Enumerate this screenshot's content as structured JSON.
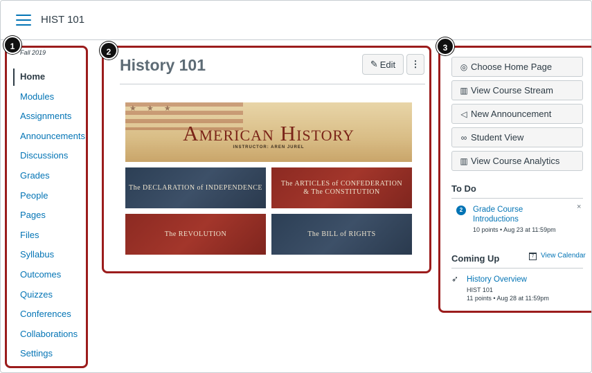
{
  "header": {
    "course_code": "HIST 101"
  },
  "callouts": {
    "one": "1",
    "two": "2",
    "three": "3"
  },
  "course_nav": {
    "term": "Fall 2019",
    "items": [
      {
        "label": "Home",
        "active": true
      },
      {
        "label": "Modules"
      },
      {
        "label": "Assignments"
      },
      {
        "label": "Announcements"
      },
      {
        "label": "Discussions"
      },
      {
        "label": "Grades"
      },
      {
        "label": "People"
      },
      {
        "label": "Pages"
      },
      {
        "label": "Files"
      },
      {
        "label": "Syllabus"
      },
      {
        "label": "Outcomes"
      },
      {
        "label": "Quizzes"
      },
      {
        "label": "Conferences"
      },
      {
        "label": "Collaborations"
      },
      {
        "label": "Settings"
      }
    ]
  },
  "main": {
    "title": "History 101",
    "edit_label": "Edit",
    "more_label": "⋮",
    "banner": {
      "title": "American History",
      "subtitle": "INSTRUCTOR: AREN JUREL"
    },
    "tiles": [
      {
        "label": "The DECLARATION of INDEPENDENCE",
        "color": "#2c3f55"
      },
      {
        "label": "The ARTICLES of CONFEDERATION & The CONSTITUTION",
        "color": "#8c2a22"
      },
      {
        "label": "The REVOLUTION",
        "color": "#8c2a22"
      },
      {
        "label": "The BILL of RIGHTS",
        "color": "#2c3f55"
      }
    ]
  },
  "sidebar": {
    "buttons": [
      {
        "label": "Choose Home Page",
        "icon": "target-icon"
      },
      {
        "label": "View Course Stream",
        "icon": "chart-icon"
      },
      {
        "label": "New Announcement",
        "icon": "megaphone-icon"
      },
      {
        "label": "Student View",
        "icon": "glasses-icon"
      },
      {
        "label": "View Course Analytics",
        "icon": "chart-icon"
      }
    ],
    "todo": {
      "heading": "To Do",
      "count": "2",
      "item_line1": "Grade Course",
      "item_line2": "Introductions",
      "item_meta": "10 points • Aug 23 at 11:59pm",
      "close": "×"
    },
    "coming_up": {
      "heading": "Coming Up",
      "calendar_link": "View Calendar",
      "calendar_icon_text": "7",
      "item_title": "History Overview",
      "item_course": "HIST 101",
      "item_meta": "11 points • Aug 28 at 11:59pm"
    }
  },
  "colors": {
    "link": "#0374b5",
    "callout": "#9b1c1c",
    "text": "#2d3b45"
  }
}
